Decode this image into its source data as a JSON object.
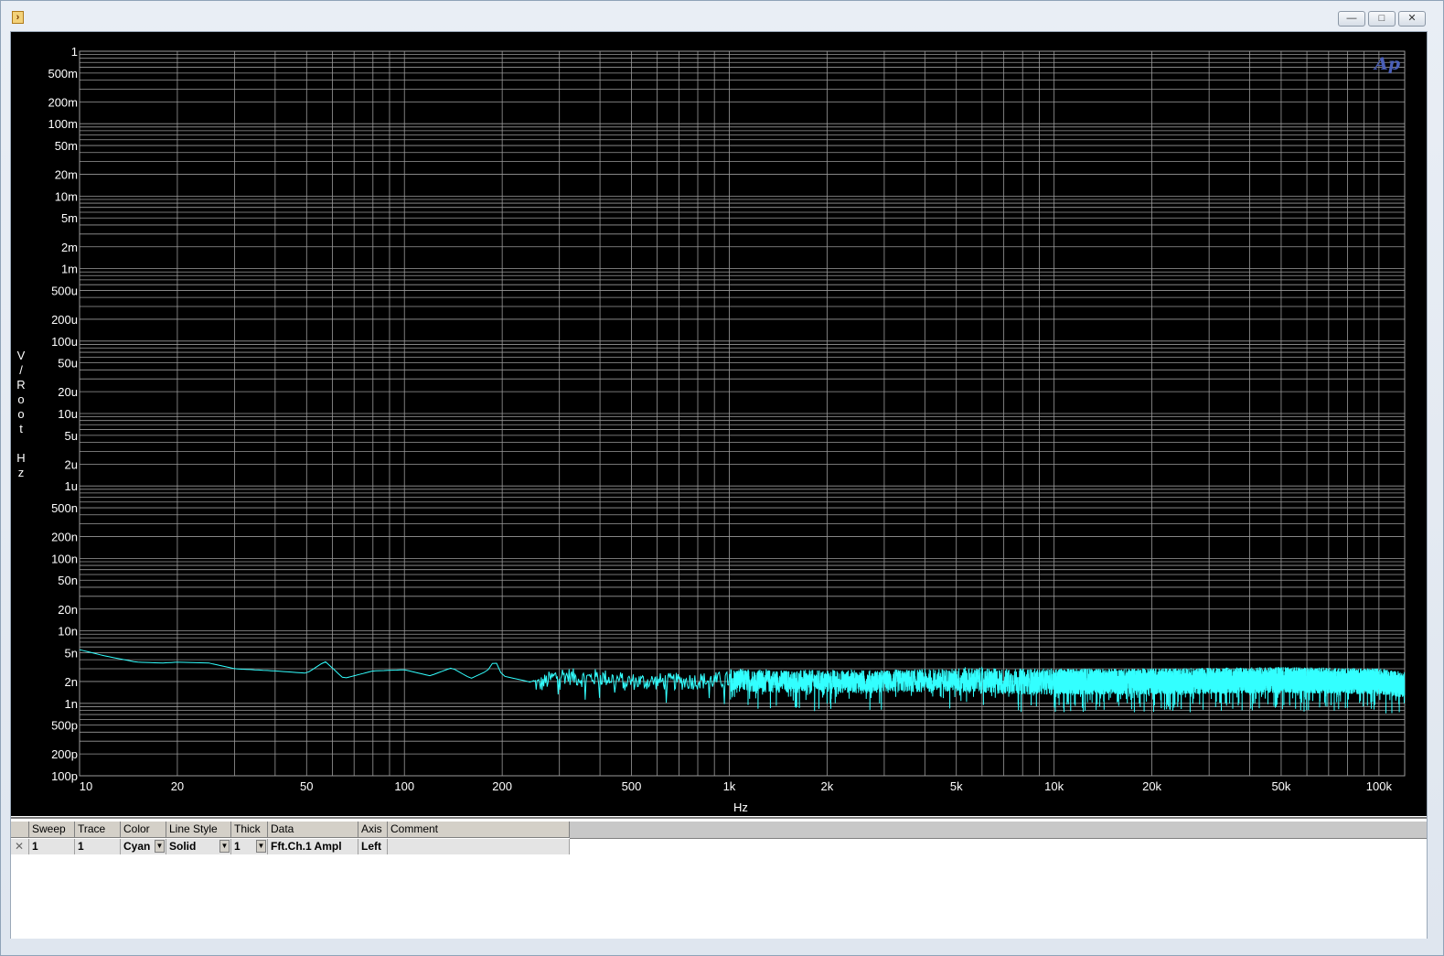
{
  "window": {
    "title": "",
    "buttons": {
      "minimize": "—",
      "maximize": "□",
      "close": "✕"
    }
  },
  "graph": {
    "logo_text": "Ap",
    "background": "#000000",
    "grid_color": "#9a9a9a",
    "trace_color": "#33ffff"
  },
  "chart_data": {
    "type": "line",
    "title": "",
    "xlabel": "Hz",
    "ylabel": "V/Root Hz",
    "xscale": "log",
    "yscale": "log",
    "xlim": [
      10,
      120000
    ],
    "ylim": [
      1e-10,
      1
    ],
    "x_ticks": [
      {
        "v": 10,
        "label": "10"
      },
      {
        "v": 20,
        "label": "20"
      },
      {
        "v": 50,
        "label": "50"
      },
      {
        "v": 100,
        "label": "100"
      },
      {
        "v": 200,
        "label": "200"
      },
      {
        "v": 500,
        "label": "500"
      },
      {
        "v": 1000,
        "label": "1k"
      },
      {
        "v": 2000,
        "label": "2k"
      },
      {
        "v": 5000,
        "label": "5k"
      },
      {
        "v": 10000,
        "label": "10k"
      },
      {
        "v": 20000,
        "label": "20k"
      },
      {
        "v": 50000,
        "label": "50k"
      },
      {
        "v": 100000,
        "label": "100k"
      }
    ],
    "y_ticks": [
      {
        "v": 1,
        "label": "1"
      },
      {
        "v": 0.5,
        "label": "500m"
      },
      {
        "v": 0.2,
        "label": "200m"
      },
      {
        "v": 0.1,
        "label": "100m"
      },
      {
        "v": 0.05,
        "label": "50m"
      },
      {
        "v": 0.02,
        "label": "20m"
      },
      {
        "v": 0.01,
        "label": "10m"
      },
      {
        "v": 0.005,
        "label": "5m"
      },
      {
        "v": 0.002,
        "label": "2m"
      },
      {
        "v": 0.001,
        "label": "1m"
      },
      {
        "v": 0.0005,
        "label": "500u"
      },
      {
        "v": 0.0002,
        "label": "200u"
      },
      {
        "v": 0.0001,
        "label": "100u"
      },
      {
        "v": 5e-05,
        "label": "50u"
      },
      {
        "v": 2e-05,
        "label": "20u"
      },
      {
        "v": 1e-05,
        "label": "10u"
      },
      {
        "v": 5e-06,
        "label": "5u"
      },
      {
        "v": 2e-06,
        "label": "2u"
      },
      {
        "v": 1e-06,
        "label": "1u"
      },
      {
        "v": 5e-07,
        "label": "500n"
      },
      {
        "v": 2e-07,
        "label": "200n"
      },
      {
        "v": 1e-07,
        "label": "100n"
      },
      {
        "v": 5e-08,
        "label": "50n"
      },
      {
        "v": 2e-08,
        "label": "20n"
      },
      {
        "v": 1e-08,
        "label": "10n"
      },
      {
        "v": 5e-09,
        "label": "5n"
      },
      {
        "v": 2e-09,
        "label": "2n"
      },
      {
        "v": 1e-09,
        "label": "1n"
      },
      {
        "v": 5e-10,
        "label": "500p"
      },
      {
        "v": 2e-10,
        "label": "200p"
      },
      {
        "v": 1e-10,
        "label": "100p"
      }
    ],
    "grid": true,
    "series": [
      {
        "name": "Fft.Ch.1 Ampl",
        "color": "#33ffff",
        "x": [
          10,
          12,
          15,
          18,
          20,
          25,
          30,
          40,
          50,
          57,
          65,
          80,
          100,
          120,
          140,
          160,
          180,
          190,
          200,
          240,
          260,
          300,
          350,
          400,
          500,
          700,
          1000,
          1500,
          2000,
          3000,
          5000,
          7000,
          10000,
          20000,
          50000,
          100000,
          120000
        ],
        "values": [
          5.5e-09,
          4.5e-09,
          3.7e-09,
          3.6e-09,
          3.7e-09,
          3.6e-09,
          3e-09,
          2.8e-09,
          2.6e-09,
          3.8e-09,
          2.2e-09,
          2.8e-09,
          2.9e-09,
          2.4e-09,
          3.1e-09,
          2.2e-09,
          2.8e-09,
          4e-09,
          2.4e-09,
          2e-09,
          1.8e-09,
          2.5e-09,
          2.2e-09,
          2.3e-09,
          2e-09,
          2e-09,
          2.1e-09,
          2e-09,
          2e-09,
          2e-09,
          2.1e-09,
          2e-09,
          2e-09,
          2e-09,
          2.1e-09,
          2e-09,
          1.8e-09
        ]
      }
    ]
  },
  "trace_table": {
    "headers": [
      "",
      "Sweep",
      "Trace",
      "Color",
      "Line Style",
      "Thick",
      "Data",
      "Axis",
      "Comment"
    ],
    "rows": [
      {
        "checked": "✕",
        "sweep": "1",
        "trace": "1",
        "color": "Cyan",
        "line_style": "Solid",
        "thick": "1",
        "data": "Fft.Ch.1 Ampl",
        "axis": "Left",
        "comment": ""
      }
    ]
  }
}
